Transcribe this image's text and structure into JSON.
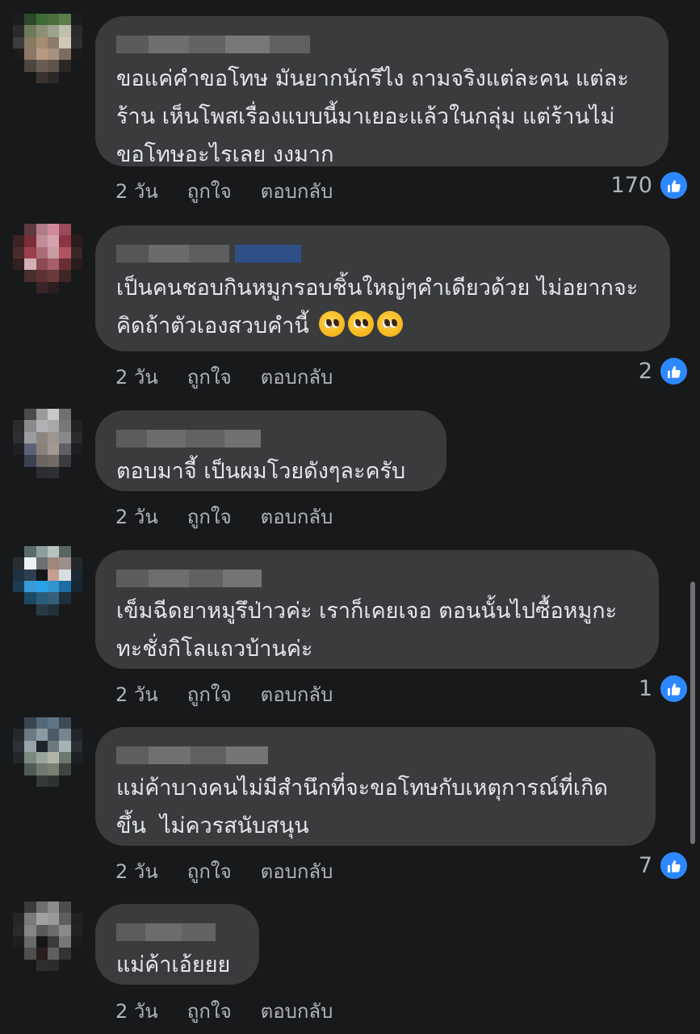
{
  "comments": [
    {
      "text": "ขอแค่คำขอโทษ มันยากนักรึไง ถามจริงแต่ละคน แต่ละร้าน เห็นโพสเรื่องแบบนี้มาเยอะแล้วในกลุ่ม แต่ร้านไม่ขอโทษอะไรเลย งงมาก",
      "time": "2 วัน",
      "like_action": "ถูกใจ",
      "reply_action": "ตอบกลับ",
      "like_count": "170"
    },
    {
      "text": "เป็นคนชอบกินหมูกรอบชิ้นใหญ่ๆคำเดียวด้วย ไม่อยากจะคิดถ้าตัวเองสวบคำนี้",
      "emoji": "pleading-face",
      "time": "2 วัน",
      "like_action": "ถูกใจ",
      "reply_action": "ตอบกลับ",
      "like_count": "2"
    },
    {
      "text": "ตอบมาจี้ เป็นผมโวยดังๆละครับ",
      "time": "2 วัน",
      "like_action": "ถูกใจ",
      "reply_action": "ตอบกลับ",
      "like_count": ""
    },
    {
      "text": "เข็มฉีดยาหมูรึป่าวค่ะ เราก็เคยเจอ ตอนนั้นไปซื้อหมูกะทะชั่งกิโลแถวบ้านค่ะ",
      "time": "2 วัน",
      "like_action": "ถูกใจ",
      "reply_action": "ตอบกลับ",
      "like_count": "1"
    },
    {
      "text": "แม่ค้าบางคนไม่มีสำนึกที่จะขอโทษกับเหตุการณ์ที่เกิดขึ้น  ไม่ควรสนับสนุน",
      "time": "2 วัน",
      "like_action": "ถูกใจ",
      "reply_action": "ตอบกลับ",
      "like_count": "7"
    },
    {
      "text": "แม่ค้าเอ้ยยย",
      "time": "2 วัน",
      "like_action": "ถูกใจ",
      "reply_action": "ตอบกลับ",
      "like_count": ""
    }
  ],
  "colors": {
    "background": "#18191a",
    "bubble": "#3a3b3c",
    "text": "#e4e6eb",
    "secondary_text": "#b0b3b8",
    "like_blue": "#2d88ff"
  }
}
